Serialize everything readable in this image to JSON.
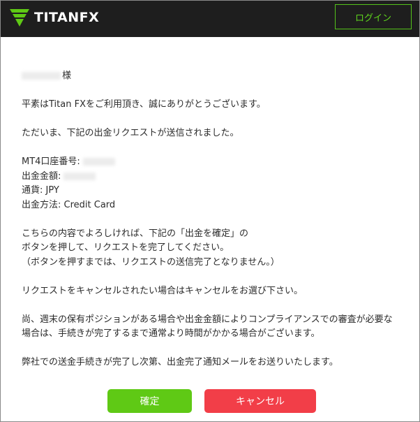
{
  "header": {
    "brand": "TITANFX",
    "login_label": "ログイン"
  },
  "email": {
    "greeting_suffix": "様",
    "thanks": "平素はTitan FXをご利用頂き、誠にありがとうございます。",
    "notice": "ただいま、下記の出金リクエストが送信されました。",
    "account_label": "MT4口座番号:",
    "amount_label": "出金金額:",
    "currency_line": "通貨: JPY",
    "method_line": "出金方法: Credit Card",
    "confirm_line_1": "こちらの内容でよろしければ、下記の「出金を確定」の",
    "confirm_line_2": "ボタンを押して、リクエストを完了してください。",
    "confirm_line_3": "（ボタンを押すまでは、リクエストの送信完了となりません。）",
    "cancel_note": "リクエストをキャンセルされたい場合はキャンセルをお選び下さい。",
    "compliance_line_1": "尚、週末の保有ポジションがある場合や出金金額によりコンプライアンスでの審査が必要な",
    "compliance_line_2": "場合は、手続きが完了するまで通常より時間がかかる場合がございます。",
    "closing": "弊社での送金手続きが完了し次第、出金完了通知メールをお送りいたします。"
  },
  "actions": {
    "confirm_label": "確定",
    "cancel_label": "キャンセル"
  },
  "colors": {
    "header_bg": "#1e1e1e",
    "brand_green": "#5fc915",
    "cancel_red": "#f23e48"
  }
}
